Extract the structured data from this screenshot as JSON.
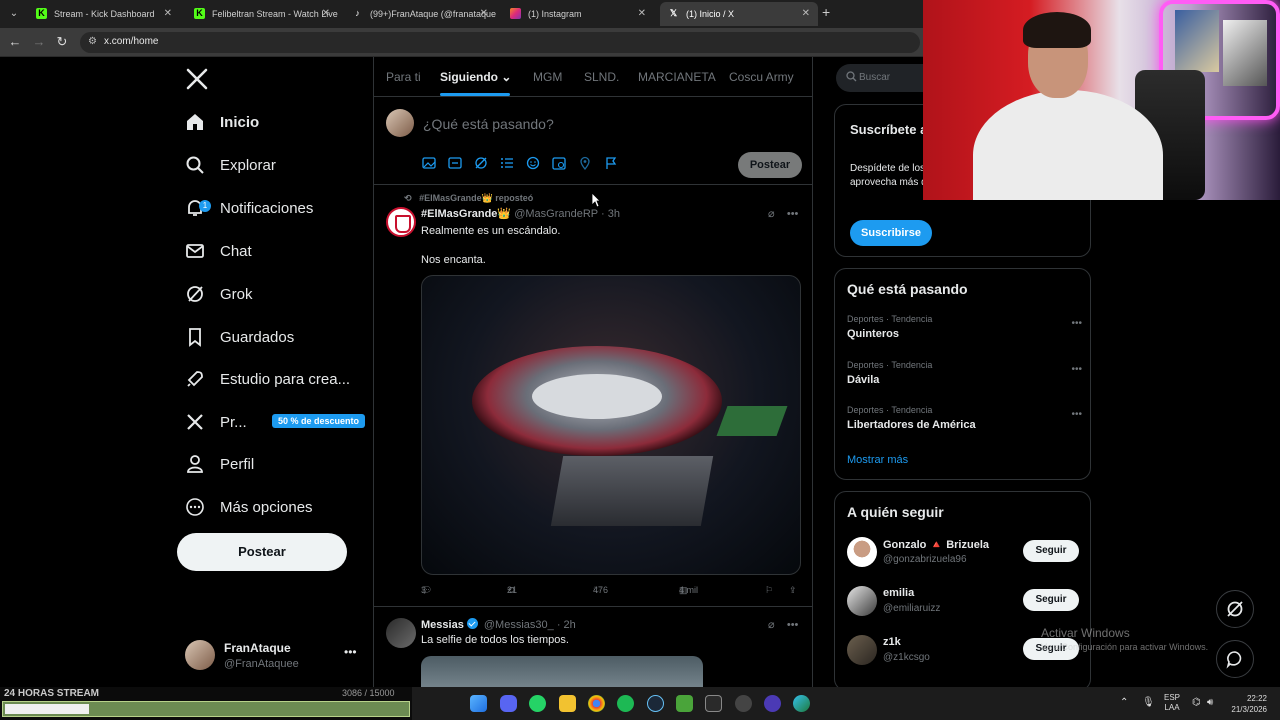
{
  "browser": {
    "tabs": [
      {
        "title": "Stream - Kick Dashboard",
        "active": false,
        "favicon_color": "#53fc18"
      },
      {
        "title": "Felibeltran Stream - Watch Live",
        "active": false,
        "favicon_color": "#53fc18"
      },
      {
        "title": "(99+)FranAtaque (@franataque)",
        "active": false,
        "favicon_color": "#ffffff"
      },
      {
        "title": "(1) Instagram",
        "active": false,
        "favicon_color": "#e1306c"
      },
      {
        "title": "(1) Inicio / X",
        "active": true,
        "favicon_color": "#ffffff"
      }
    ],
    "url": "x.com/home"
  },
  "leftnav": {
    "items": [
      {
        "label": "Inicio",
        "icon": "home-icon"
      },
      {
        "label": "Explorar",
        "icon": "search-icon"
      },
      {
        "label": "Notificaciones",
        "icon": "bell-icon",
        "badge": "1"
      },
      {
        "label": "Chat",
        "icon": "mail-icon"
      },
      {
        "label": "Grok",
        "icon": "grok-icon"
      },
      {
        "label": "Guardados",
        "icon": "bookmark-icon"
      },
      {
        "label": "Estudio para crea...",
        "icon": "rocket-icon"
      },
      {
        "label": "Pr...",
        "icon": "x-logo-icon",
        "promo": "50 % de descuento"
      },
      {
        "label": "Perfil",
        "icon": "person-icon"
      },
      {
        "label": "Más opciones",
        "icon": "more-circle-icon"
      }
    ],
    "post_button": "Postear",
    "account": {
      "name": "FranAtaque",
      "handle": "@FranAtaquee"
    }
  },
  "feed": {
    "tabs": [
      "Para ti",
      "Siguiendo",
      "MGM",
      "SLND.",
      "MARCIANETA",
      "Coscu Army"
    ],
    "active_tab": "Siguiendo",
    "composer": {
      "placeholder": "¿Qué está pasando?",
      "post_button": "Postear"
    },
    "tweets": [
      {
        "repost_line": "#ElMasGrande👑 reposteó",
        "name": "#ElMasGrande👑",
        "handle": "@MasGrandeRP",
        "time": "· 3h",
        "text1": "Realmente es un escándalo.",
        "text2": "Nos encanta.",
        "replies": "3",
        "reposts": "21",
        "likes": "476",
        "views": "4 mil"
      },
      {
        "name": "Messias",
        "handle": "@Messias30_",
        "time": "· 2h",
        "text1": "La selfie de todos los tiempos."
      }
    ]
  },
  "rightcol": {
    "search_placeholder": "Buscar",
    "premium": {
      "title": "Suscríbete a Premium",
      "desc": "Despídete de los anuncios, consulta estadísticas, aprovecha más de tus características.",
      "button": "Suscribirse"
    },
    "trends_title": "Qué está pasando",
    "trends": [
      {
        "category": "Deportes · Tendencia",
        "name": "Quinteros"
      },
      {
        "category": "Deportes · Tendencia",
        "name": "Dávila"
      },
      {
        "category": "Deportes · Tendencia",
        "name": "Libertadores de América"
      }
    ],
    "show_more": "Mostrar más",
    "follow_title": "A quién seguir",
    "follow": [
      {
        "name": "Gonzalo 🔺 Brizuela",
        "handle": "@gonzabrizuela96",
        "button": "Seguir"
      },
      {
        "name": "emilia",
        "handle": "@emiliaruizz",
        "button": "Seguir"
      },
      {
        "name": "z1k",
        "handle": "@z1kcsgo",
        "button": "Seguir"
      }
    ]
  },
  "watermark": {
    "line1": "Activar Windows",
    "line2": "Ve a Configuración para activar Windows."
  },
  "stream_overlay": {
    "label": "24 HORAS STREAM",
    "count": "3086 / 15000",
    "progress": 0.21
  },
  "taskbar": {
    "lang1": "ESP",
    "lang2": "LAA",
    "time": "22:22",
    "date": "21/3/2026"
  },
  "colors": {
    "accent": "#1d9bf0",
    "background": "#000000",
    "border": "#2f3336"
  }
}
